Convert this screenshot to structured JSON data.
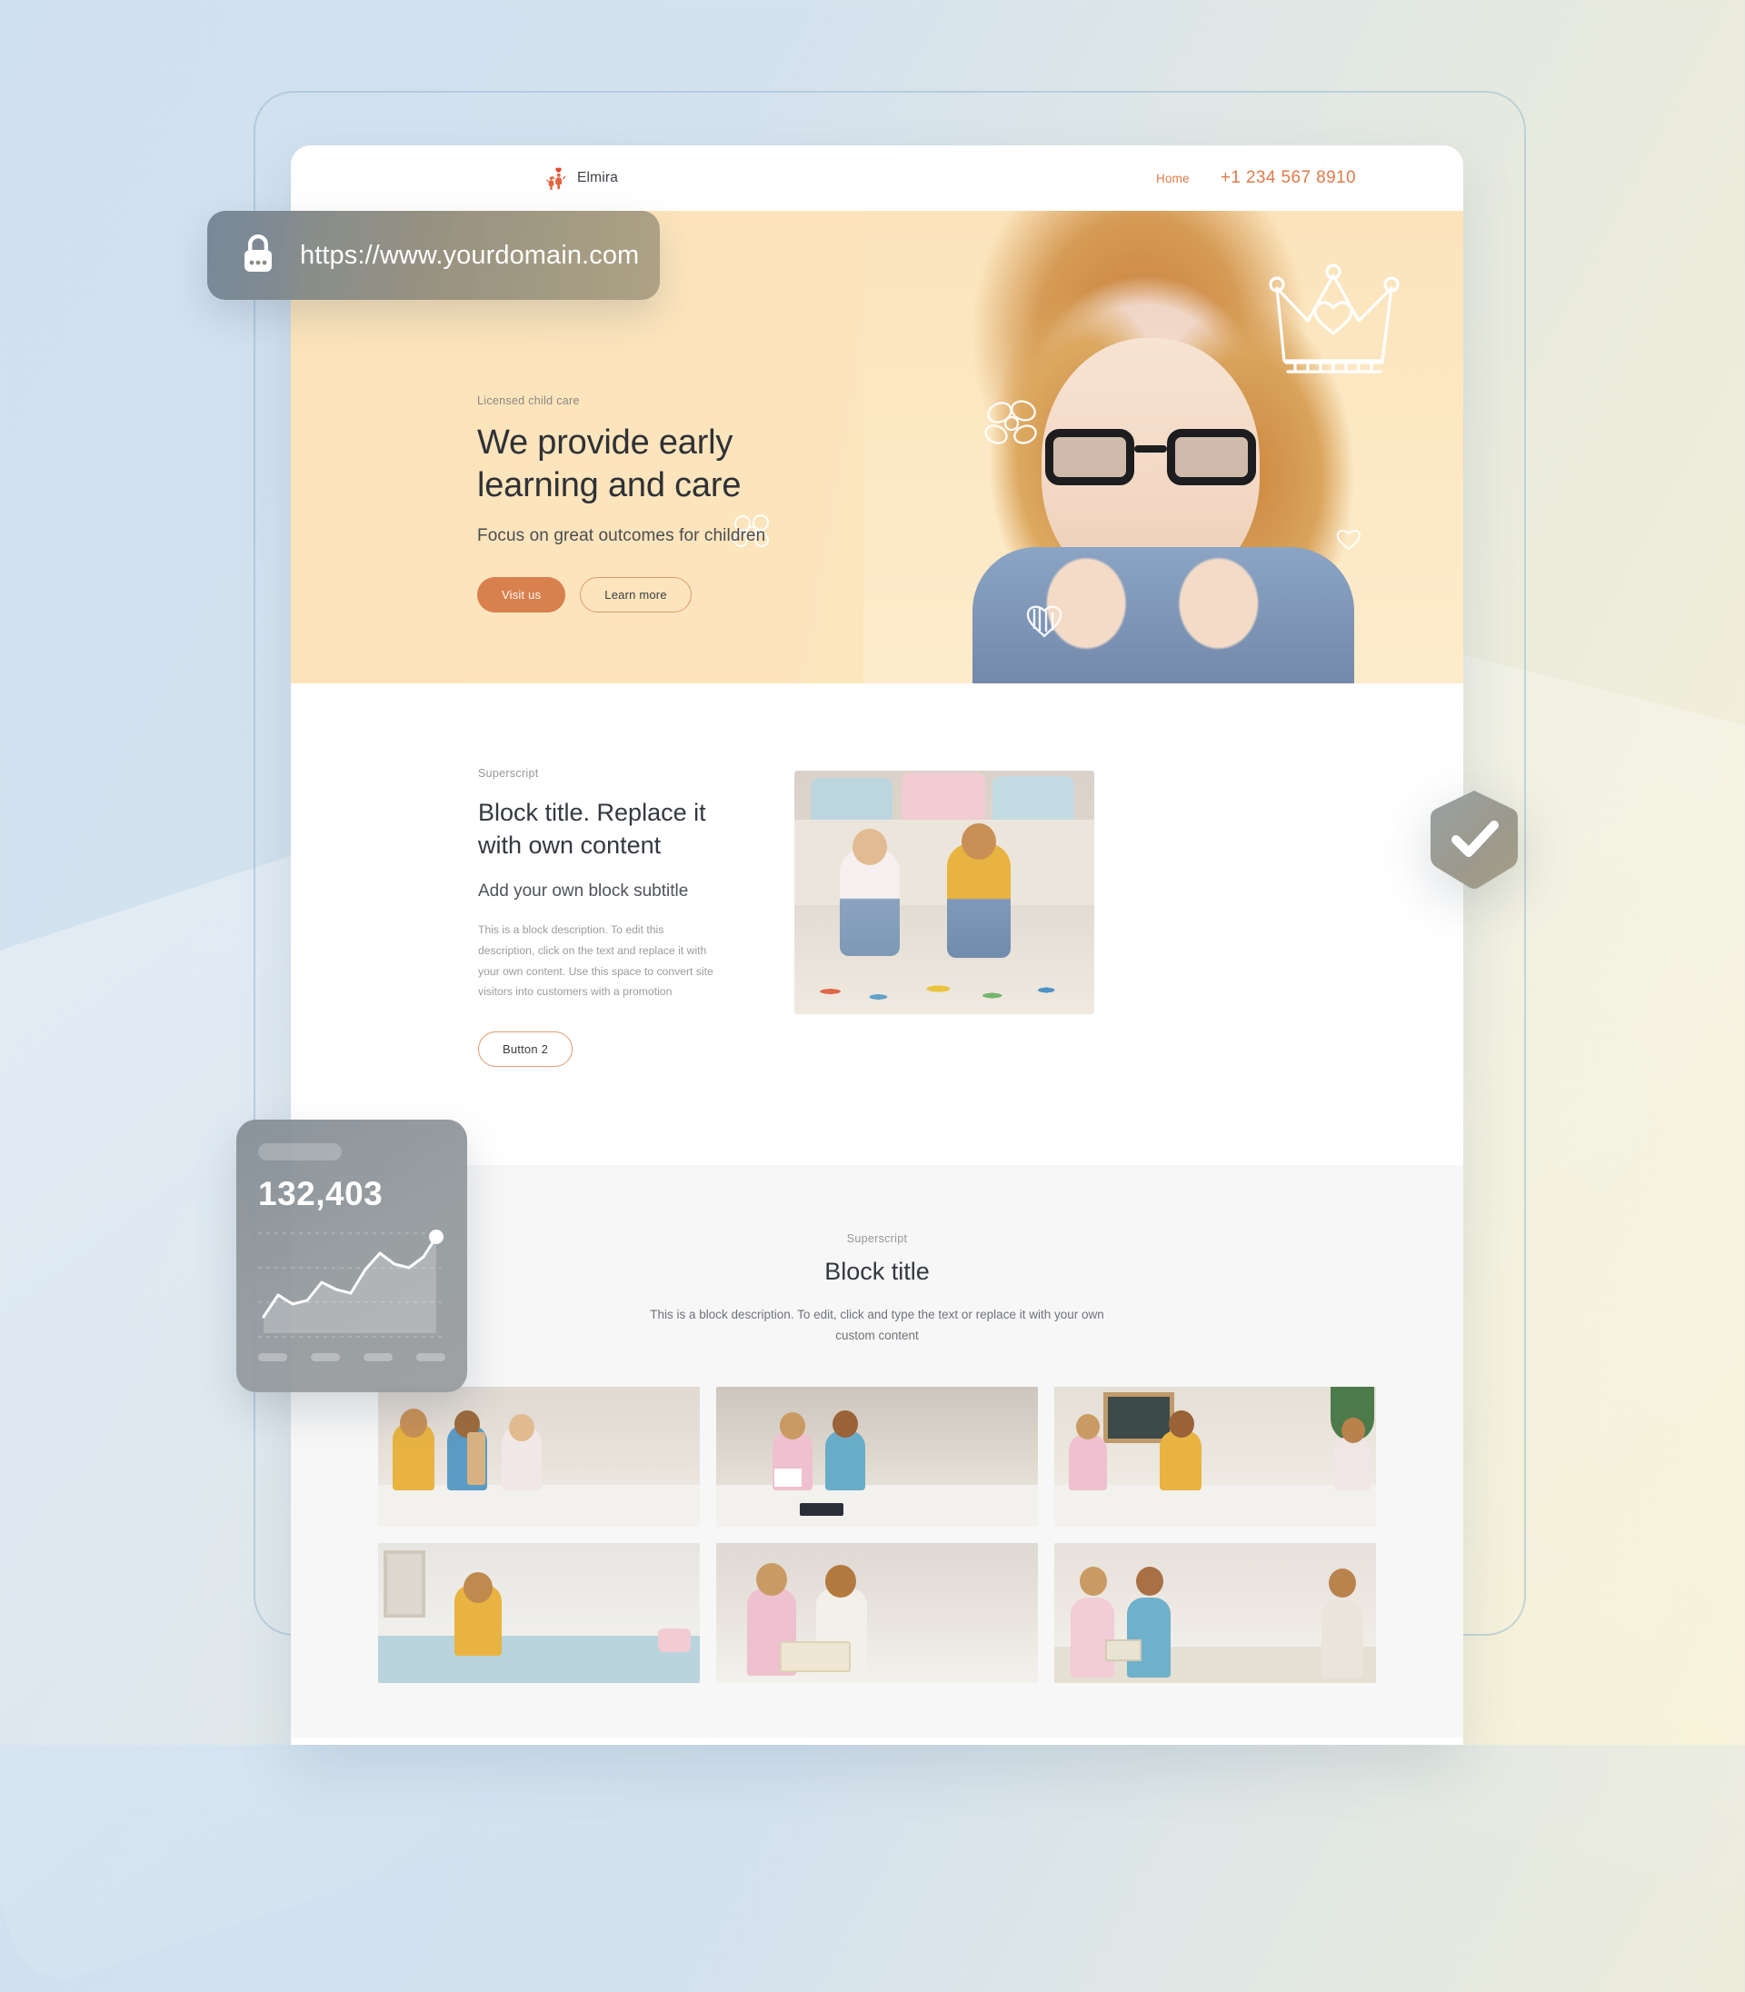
{
  "browser": {
    "url": "https://www.yourdomain.com",
    "lock_icon": "lock-icon",
    "secure": true
  },
  "site": {
    "nav": {
      "brand": "Elmira",
      "brand_icon": "family-heart-logo-icon",
      "links": [
        {
          "label": "Home"
        }
      ],
      "phone": "+1 234 567 8910"
    },
    "hero": {
      "eyebrow": "Licensed child care",
      "title_line_1": "We provide early",
      "title_line_2": "learning and care",
      "subtitle": "Focus on great outcomes for children",
      "primary_button": "Visit us",
      "secondary_button": "Learn more",
      "decorations": [
        "crown-doodle-icon",
        "heart-doodle-icon",
        "flower-doodle-icon",
        "star-doodle-icon"
      ]
    },
    "block_two": {
      "eyebrow": "Superscript",
      "title": "Block title. Replace it with own content",
      "subtitle": "Add your own block subtitle",
      "description": "This is a block description. To edit this description, click on the text and replace it with your own content. Use this space to convert site visitors into customers with a promotion",
      "button": "Button 2",
      "image_alt": "two-children-playing-on-rug"
    },
    "block_three": {
      "eyebrow": "Superscript",
      "title": "Block title",
      "description": "This is a block description. To edit, click and type the text or replace it with your own custom content",
      "gallery": [
        {
          "alt": "three-children-stacking-wooden-blocks"
        },
        {
          "alt": "two-girls-painting-with-watercolors"
        },
        {
          "alt": "children-drawing-at-table-with-chalkboard"
        },
        {
          "alt": "boy-playing-with-wooden-toy-on-couch"
        },
        {
          "alt": "boy-and-girl-reading-a-book"
        },
        {
          "alt": "three-children-reading-books-on-sofa"
        }
      ]
    }
  },
  "widgets": {
    "analytics": {
      "value": "132,403",
      "title_placeholder": "",
      "chart_icon": "line-chart-icon"
    },
    "badge": {
      "icon": "shield-check-icon",
      "label": "verified"
    }
  },
  "colors": {
    "accent": "#e07a49",
    "primary_button": "#d9804f",
    "hero_bg": "#fbe4bc",
    "page_bg_start": "#cfe0ef",
    "page_bg_end": "#f7f2d6",
    "text_dark": "#2f3136",
    "text_muted": "#9b9aa0"
  },
  "chart_data": {
    "type": "line",
    "title": "132,403",
    "x": [
      0,
      1,
      2,
      3,
      4,
      5,
      6,
      7,
      8,
      9,
      10,
      11,
      12
    ],
    "values": [
      18,
      42,
      33,
      38,
      58,
      52,
      48,
      70,
      86,
      74,
      70,
      82,
      100
    ],
    "xlabel": "",
    "ylabel": "",
    "ylim": [
      0,
      110
    ],
    "grid": true,
    "legend": "none",
    "marker_last_point": true
  }
}
